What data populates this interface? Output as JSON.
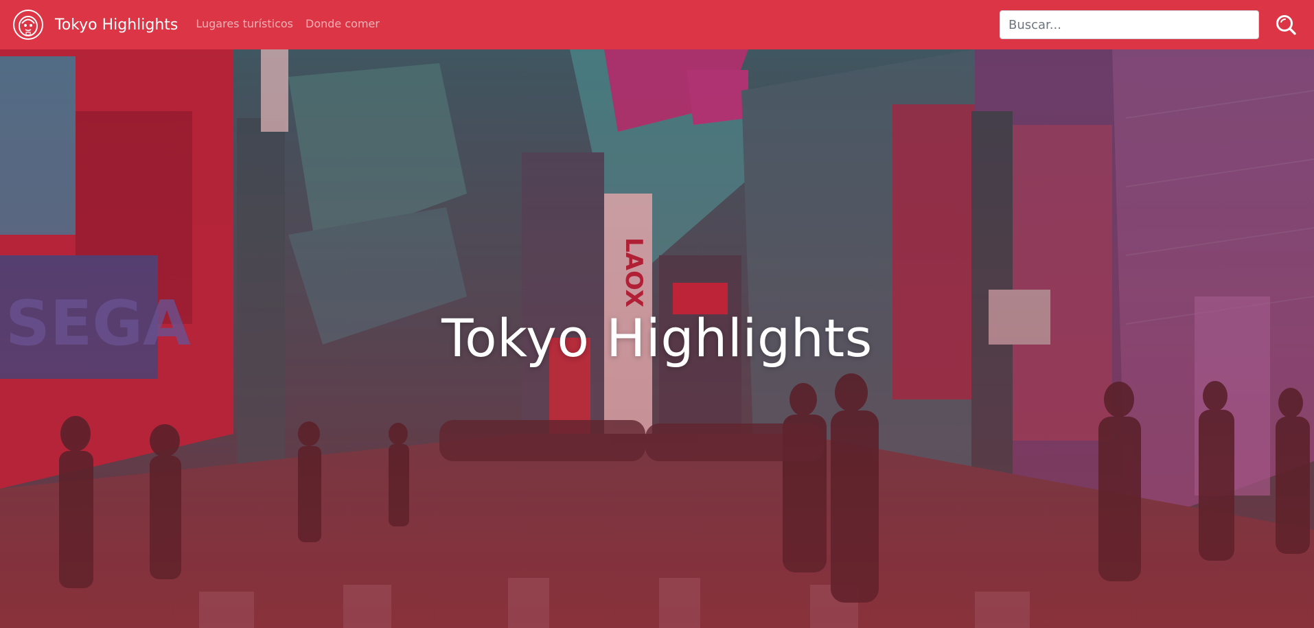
{
  "navbar": {
    "logo_icon": "daruma-logo-icon",
    "brand": "Tokyo Highlights",
    "links": [
      {
        "label": "Lugares turísticos"
      },
      {
        "label": "Donde comer"
      }
    ],
    "search": {
      "placeholder": "Buscar...",
      "value": "",
      "button_icon": "search-icon"
    },
    "background_color": "#dc3545"
  },
  "hero": {
    "title": "Tokyo Highlights",
    "background_image": "photo-of-tokyo-akihabara-street-with-red-overlay",
    "overlay_color": "#dc3545"
  }
}
